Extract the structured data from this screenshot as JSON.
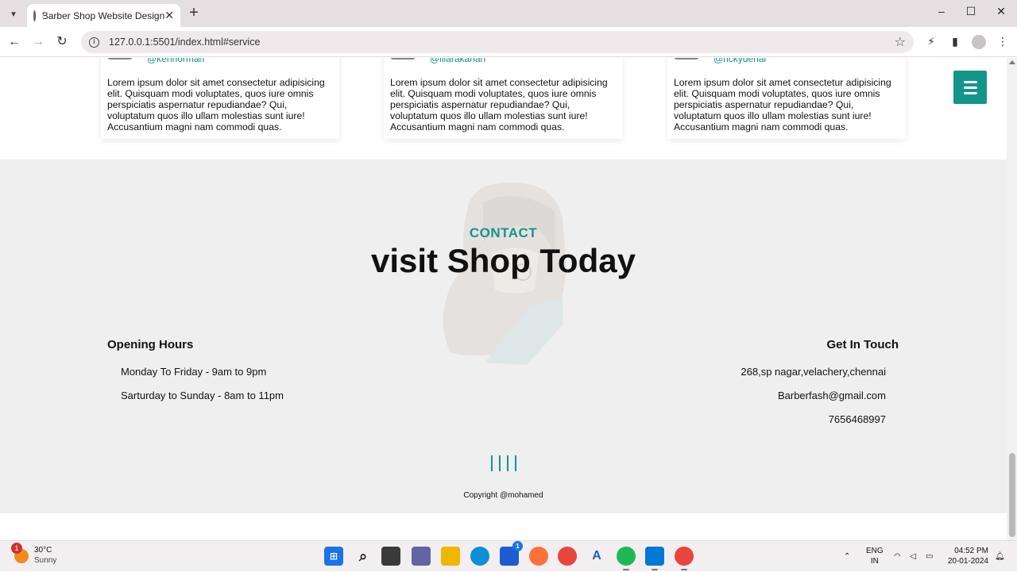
{
  "browser": {
    "tab_title": "Barber Shop Website Design",
    "url": "127.0.0.1:5501/index.html#service",
    "new_tab": "+",
    "close_tab": "✕"
  },
  "reviews": [
    {
      "handle": "@kennorman",
      "text": "Lorem ipsum dolor sit amet consectetur adipisicing elit. Quisquam modi voluptates, quos iure omnis perspiciatis aspernatur repudiandae? Qui, voluptatum quos illo ullam molestias sunt iure! Accusantium magni nam commodi quas."
    },
    {
      "handle": "@lilarakahan",
      "text": "Lorem ipsum dolor sit amet consectetur adipisicing elit. Quisquam modi voluptates, quos iure omnis perspiciatis aspernatur repudiandae? Qui, voluptatum quos illo ullam molestias sunt iure! Accusantium magni nam commodi quas."
    },
    {
      "handle": "@rickydenal",
      "text": "Lorem ipsum dolor sit amet consectetur adipisicing elit. Quisquam modi voluptates, quos iure omnis perspiciatis aspernatur repudiandae? Qui, voluptatum quos illo ullam molestias sunt iure! Accusantium magni nam commodi quas."
    }
  ],
  "contact": {
    "subtitle": "CONTACT",
    "title": "visit Shop Today",
    "hours": {
      "heading": "Opening Hours",
      "lines": [
        "Monday To Friday - 9am to 9pm",
        "Sarturday to Sunday - 8am to 11pm"
      ]
    },
    "touch": {
      "heading": "Get In Touch",
      "address": "268,sp nagar,velachery,chennai",
      "email": "Barberfash@gmail.com",
      "phone": "7656468997"
    }
  },
  "footer": {
    "copyright": "Copyright @mohamed"
  },
  "colors": {
    "accent": "#14958a",
    "section_bg": "#efefef"
  },
  "taskbar": {
    "weather_badge": "1",
    "temperature": "30°C",
    "condition": "Sunny",
    "store_badge": "1",
    "lang_1": "ENG",
    "lang_2": "IN",
    "time": "04:52 PM",
    "date": "20-01-2024"
  }
}
